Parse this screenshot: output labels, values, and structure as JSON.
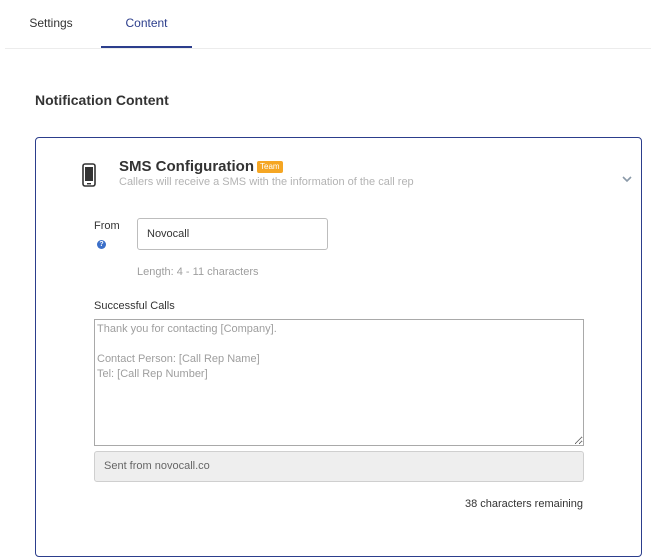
{
  "tabs": [
    {
      "label": "Settings",
      "active": false
    },
    {
      "label": "Content",
      "active": true
    }
  ],
  "section_title": "Notification Content",
  "sms": {
    "title": "SMS Configuration",
    "badge": "Team",
    "subtitle": "Callers will receive a SMS with the information of the call rep",
    "icon": "phone-icon",
    "from": {
      "label": "From",
      "value": "Novocall",
      "length_hint": "Length: 4 - 11 characters"
    },
    "successful_calls": {
      "label": "Successful Calls",
      "placeholder": "Thank you for contacting [Company].\n\nContact Person: [Call Rep Name]\nTel: [Call Rep Number]",
      "footer": "Sent from novocall.co",
      "remaining": "38 characters remaining"
    }
  },
  "colors": {
    "accent": "#2c3e8c",
    "badge": "#f5a623",
    "help_icon": "#3b6fc9"
  }
}
